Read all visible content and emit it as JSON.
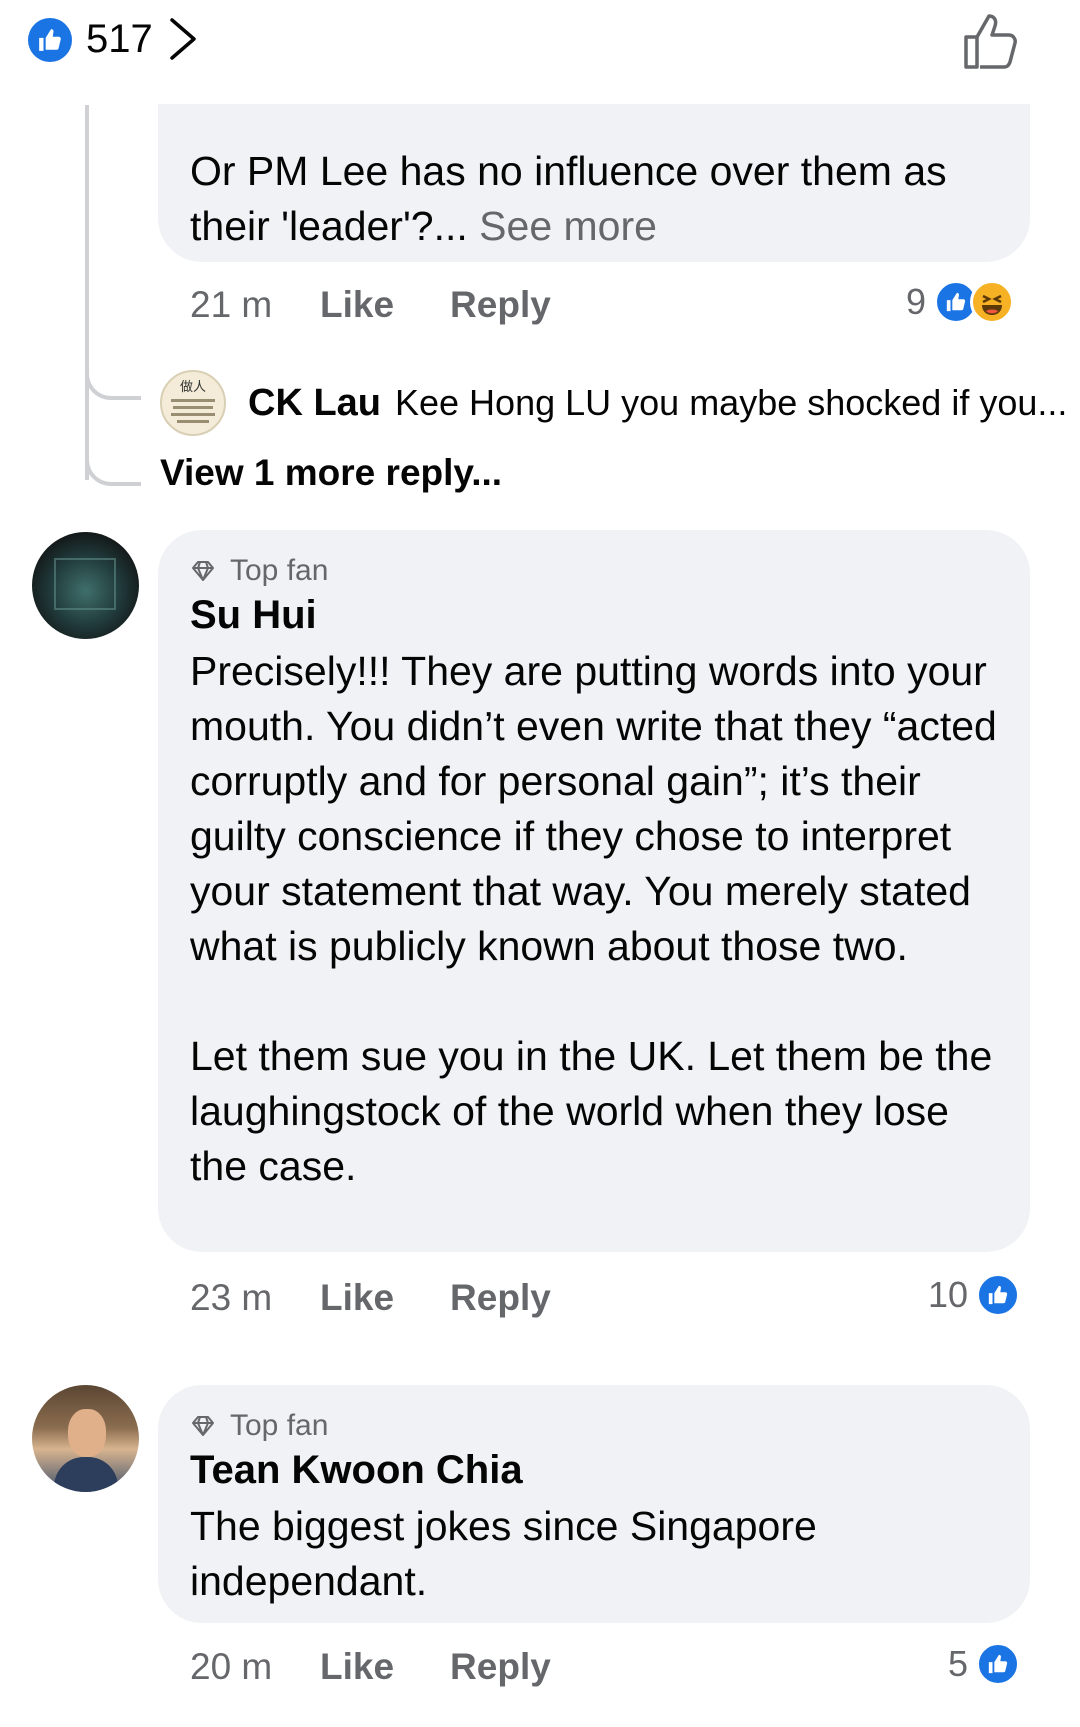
{
  "top": {
    "reaction_count": "517",
    "like_icon": "thumbs-up-icon",
    "chevron_icon": "chevron-right-icon",
    "like_outline_icon": "like-outline-icon"
  },
  "comments": [
    {
      "text": "Or PM Lee has no influence over them as their 'leader'?...",
      "see_more": "See more",
      "time": "21 m",
      "like": "Like",
      "reply": "Reply",
      "reactions": "9"
    },
    {
      "badge": "Top fan",
      "author": "Su Hui",
      "paragraph1": "Precisely!!! They are putting words into your mouth. You didn’t even write that they “acted corruptly and for personal gain”; it’s their guilty conscience if they chose to interpret your statement that way. You merely stated what is publicly known about those two.",
      "paragraph2": "Let them sue you in the UK. Let them be the laughingstock of the world when they lose the case.",
      "time": "23 m",
      "like": "Like",
      "reply": "Reply",
      "reactions": "10"
    },
    {
      "badge": "Top fan",
      "author": "Tean Kwoon Chia",
      "text": "The biggest jokes since Singapore independant.",
      "time": "20 m",
      "like": "Like",
      "reply": "Reply",
      "reactions": "5"
    }
  ],
  "reply_preview": {
    "author": "CK Lau",
    "text": "Kee Hong LU you maybe shocked if you...",
    "avatar_text": "做人"
  },
  "view_more_replies": "View 1 more reply...",
  "colors": {
    "accent": "#1b74e4",
    "bubble": "#f0f2f5",
    "meta": "#65676b"
  }
}
